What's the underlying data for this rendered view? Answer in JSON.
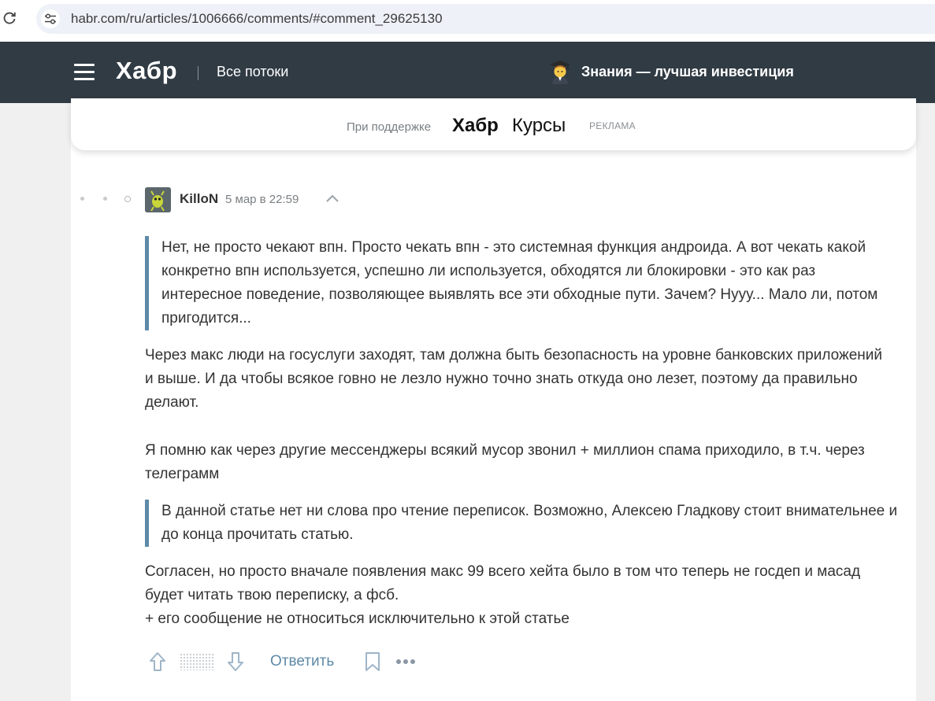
{
  "browser": {
    "url": "habr.com/ru/articles/1006666/comments/#comment_29625130"
  },
  "header": {
    "logo": "Хабр",
    "streams_label": "Все потоки",
    "promo_text": "Знания — лучшая инвестиция",
    "promo_icon": "student-emoji-icon"
  },
  "sponsor": {
    "label": "При поддержке",
    "brand_bold": "Хабр",
    "brand": "Курсы",
    "ad_label": "РЕКЛАМА"
  },
  "comment": {
    "author": "KilloN",
    "date": "5 мар в 22:59",
    "quote_1": "Нет, не просто чекают впн. Просто чекать впн - это системная функция андроида. А вот чекать какой конкретно впн используется, успешно ли используется, обходятся ли блокировки - это как раз интересное поведение, позволяющее выявлять все эти обходные пути. Зачем? Нууу... Мало ли, потом пригодится...",
    "para_1": "Через макс люди на госуслуги заходят, там должна быть безопасность на уровне банковских приложений и выше. И да чтобы всякое говно не лезло нужно точно знать откуда оно лезет, поэтому да правильно делают.",
    "para_2": "Я помню как через другие мессенджеры всякий мусор звонил + миллион спама приходило, в т.ч. через телеграмм",
    "quote_2": "В данной статье нет ни слова про чтение переписок. Возможно, Алексею Гладкову стоит внимательнее и до конца прочитать статью.",
    "para_3": "Согласен, но просто вначале появления макс 99 всего хейта было в том что теперь не госдеп и масад будет читать твою переписку, а фсб.\n+ его сообщение не относиться исключительно к этой статье",
    "reply_label": "Ответить"
  },
  "colors": {
    "header_bg": "#303b44",
    "accent": "#5e8aa8",
    "page_bg": "#f0f0f0"
  }
}
